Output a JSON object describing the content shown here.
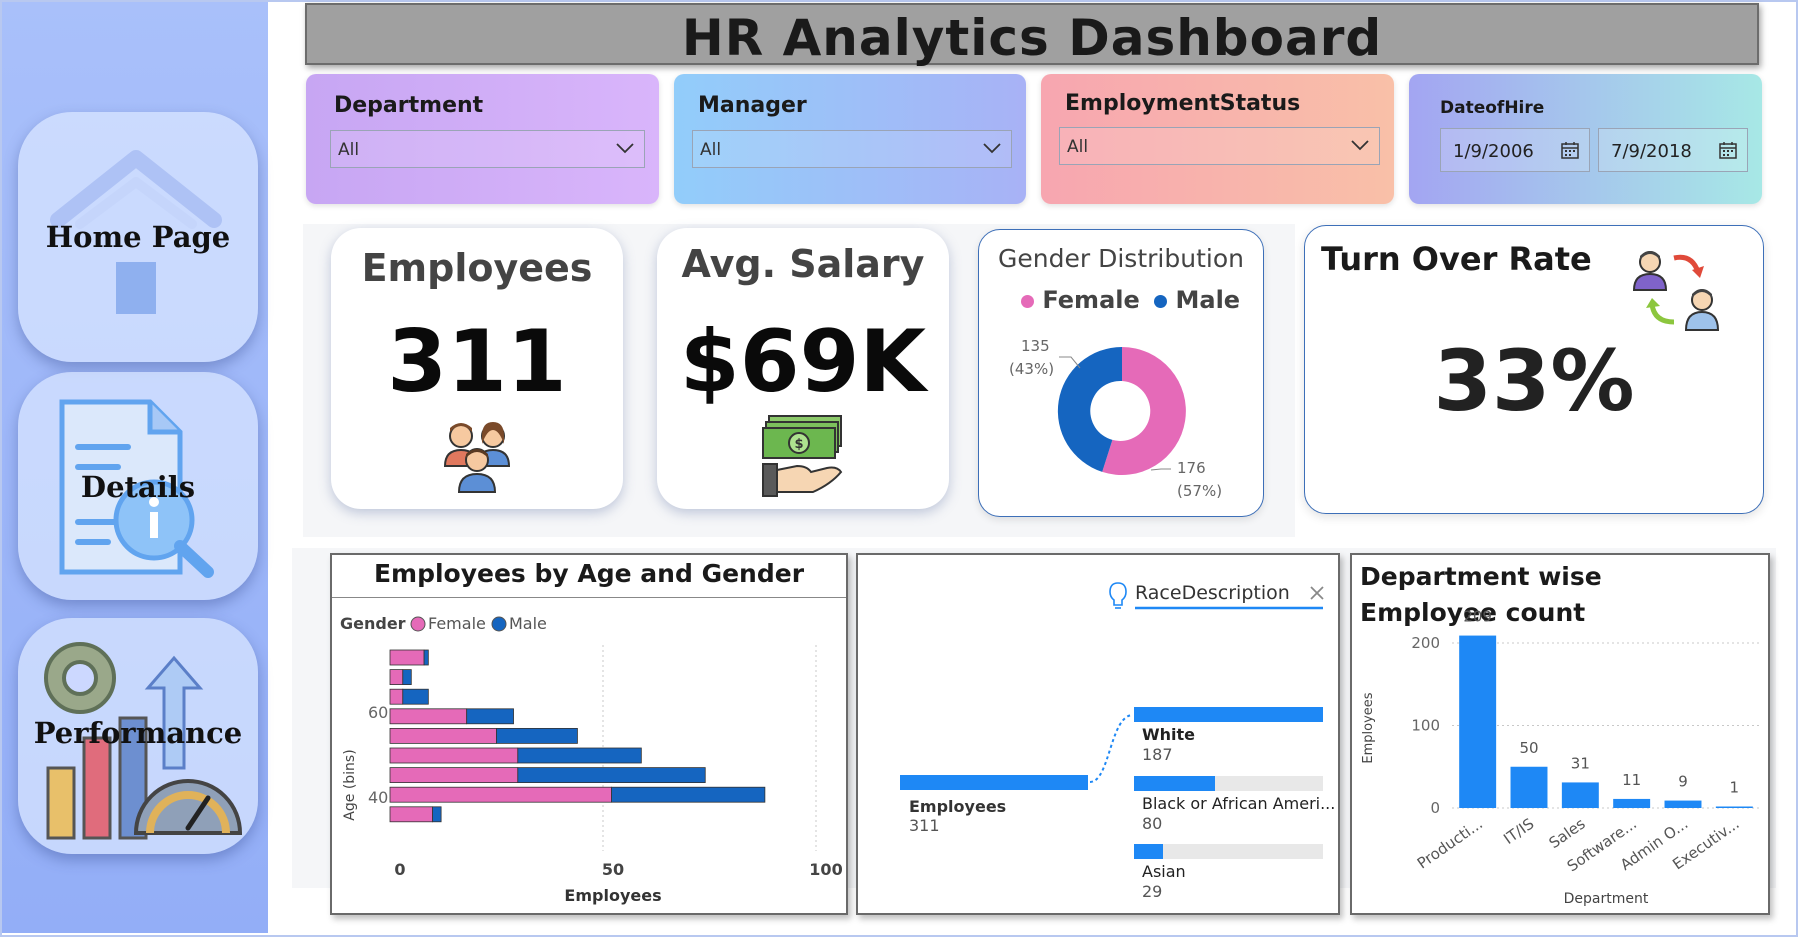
{
  "sidebar": {
    "items": [
      {
        "label": "Home Page",
        "icon": "house-icon"
      },
      {
        "label": "Details",
        "icon": "document-search-icon"
      },
      {
        "label": "Performance",
        "icon": "performance-icon"
      }
    ]
  },
  "header": {
    "title": "HR Analytics Dashboard"
  },
  "filters": {
    "department": {
      "label": "Department",
      "value": "All"
    },
    "manager": {
      "label": "Manager",
      "value": "All"
    },
    "employment_status": {
      "label": "EmploymentStatus",
      "value": "All"
    },
    "date_of_hire": {
      "label": "DateofHire",
      "start": "1/9/2006",
      "end": "7/9/2018"
    }
  },
  "kpis": {
    "employees": {
      "label": "Employees",
      "value": "311",
      "icon": "people-group-icon"
    },
    "avg_salary": {
      "label": "Avg. Salary",
      "value": "$69K",
      "icon": "money-hand-icon"
    },
    "turnover": {
      "label": "Turn Over Rate",
      "value": "33%",
      "icon": "employee-exchange-icon"
    }
  },
  "colors": {
    "female": "#e56ab8",
    "male": "#1565c0",
    "bar": "#1e88f5",
    "track": "#e8e8e8"
  },
  "gender_chart": {
    "title": "Gender Distribution",
    "legend": [
      "Female",
      "Male"
    ],
    "female_count": "176",
    "female_pct": "(57%)",
    "male_count": "135",
    "male_pct": "(43%)"
  },
  "decomp": {
    "field_label": "RaceDescription",
    "root_label": "Employees",
    "root_value": "311",
    "nodes": [
      {
        "label": "White",
        "value": "187"
      },
      {
        "label": "Black or African Ameri...",
        "value": "80"
      },
      {
        "label": "Asian",
        "value": "29"
      }
    ]
  },
  "chart_data": [
    {
      "type": "bar",
      "orientation": "horizontal-stacked",
      "title": "Employees by Age and Gender",
      "legend_title": "Gender",
      "legend": [
        "Female",
        "Male"
      ],
      "xlabel": "Employees",
      "ylabel": "Age (bins)",
      "xlim": [
        0,
        100
      ],
      "x_ticks": [
        "0",
        "50",
        "100"
      ],
      "y_ticks": [
        "60",
        "40"
      ],
      "series": [
        {
          "name": "Female",
          "values": [
            8,
            3,
            3,
            18,
            25,
            30,
            30,
            52,
            10
          ]
        },
        {
          "name": "Male",
          "values": [
            1,
            2,
            6,
            11,
            19,
            29,
            44,
            36,
            2
          ]
        }
      ],
      "grid": true
    },
    {
      "type": "bar",
      "title": "Department wise Employee count",
      "categories": [
        "Producti...",
        "IT/IS",
        "Sales",
        "Software...",
        "Admin O...",
        "Executiv..."
      ],
      "values": [
        209,
        50,
        31,
        11,
        9,
        1
      ],
      "xlabel": "Department",
      "ylabel": "Employees",
      "ylim": [
        0,
        240
      ],
      "y_ticks": [
        "0",
        "100",
        "200"
      ],
      "grid": true
    }
  ]
}
